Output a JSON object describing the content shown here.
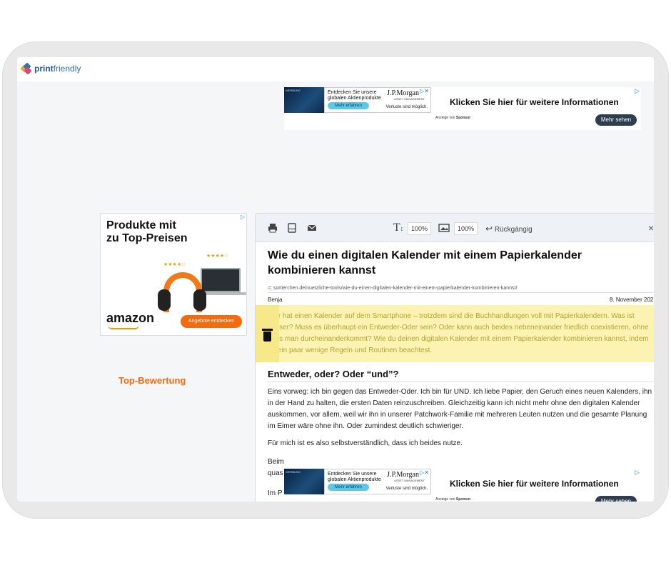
{
  "app": {
    "logo_print": "print",
    "logo_friendly": "friendly"
  },
  "colors": {
    "accent": "#3b6ea5",
    "highlight": "#fcf3b3",
    "ad_orange": "#f26b0f"
  },
  "ad_top": {
    "img_label": "WERBUNG",
    "text": "Entdecken Sie unsere globalen Aktienprodukte",
    "brand": "J.P.Morgan",
    "brand_sub": "ASSET MANAGEMENT",
    "button": "Mehr erfahren",
    "disclaimer": "Verluste sind möglich.",
    "anzeige": "Anzeige von",
    "sponsor": "Sponsor",
    "headline": "Klicken Sie hier für weitere Informationen",
    "cta": "Mehr sehen"
  },
  "ad_side": {
    "line1": "Produkte mit",
    "line2": "Top-Bewertung",
    "line3": "zu Top-Preisen",
    "stars_a": "★★★★☆",
    "stars_b": "★★★★☆",
    "brand": "amazon",
    "cta": "Angebote entdecken"
  },
  "toolbar": {
    "print_icon": "printer-icon",
    "pdf_icon": "pdf-icon",
    "email_icon": "email-icon",
    "text_size": "100%",
    "image_size": "100%",
    "undo": "Rückgängig",
    "close": "×"
  },
  "article": {
    "title": "Wie du einen digitalen Kalender mit einem Papierkalender kombinieren kannst",
    "url": "sortierchen.de/nuetzliche-tools/wie-du-einen-digitalen-kalender-mit-einem-papierkalender-kombinieren-kannst/",
    "author": "Benja",
    "date": "8. November 202",
    "intro": "Wer hat einen Kalender auf dem Smartphone – trotzdem sind die Buchhandlungen voll mit Papierkalendern. Was ist besser? Muss es überhaupt ein Entweder-Oder sein? Oder kann auch beides nebeneinander friedlich coexistieren, ohne dass man durcheinanderkommt? Wie du deinen digitalen Kalender mit einem Papierkalender kombinieren kannst, indem du ein paar wenige Regeln und Routinen beachtest.",
    "heading": "Entweder, oder? Oder “und”?",
    "p1": "Eins vorweg: ich bin gegen das Entweder-Oder. Ich bin für UND. Ich liebe Papier, den Geruch eines neuen Kalenders, ihn in der Hand zu halten, die ersten Daten reinzuschreiben. Gleichzeitig kann ich nicht mehr ohne den digitalen Kalender auskommen, vor allem, weil wir ihn in unserer Patchwork-Familie mit mehreren Leuten nutzen und die gesamte Planung im Eimer wäre ohne ihn. Oder zumindest deutlich schwieriger.",
    "p2": "Für mich ist es also selbstverständlich, dass ich beides nutze.",
    "p3": "Beim",
    "p4": "quas",
    "p5": "Im P"
  }
}
